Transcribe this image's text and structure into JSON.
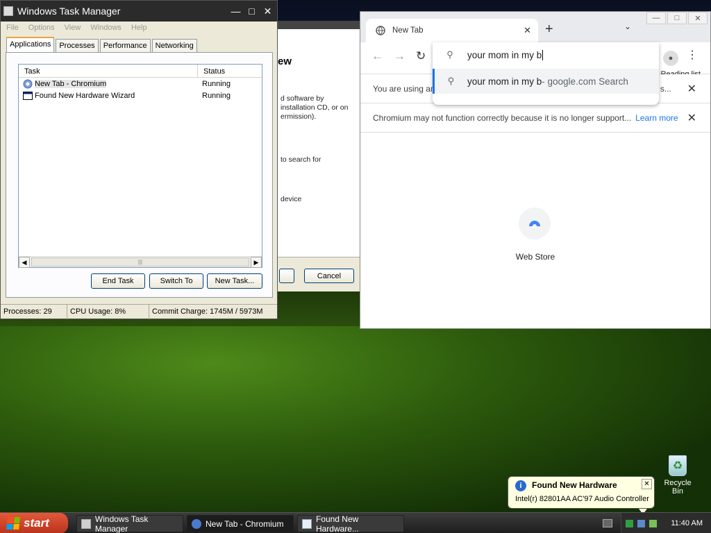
{
  "task_manager": {
    "title": "Windows Task Manager",
    "menu": [
      "File",
      "Options",
      "View",
      "Windows",
      "Help"
    ],
    "tabs": [
      "Applications",
      "Processes",
      "Performance",
      "Networking"
    ],
    "columns": {
      "task": "Task",
      "status": "Status"
    },
    "rows": [
      {
        "task": "New Tab - Chromium",
        "status": "Running"
      },
      {
        "task": "Found New Hardware Wizard",
        "status": "Running"
      }
    ],
    "buttons": {
      "end_task": "End Task",
      "switch_to": "Switch To",
      "new_task": "New Task..."
    },
    "status": {
      "processes": "Processes: 29",
      "cpu": "CPU Usage: 8%",
      "commit": "Commit Charge: 1745M / 5973M"
    }
  },
  "wizard": {
    "title_fragment": "ew",
    "p1": [
      "d software by",
      "installation CD, or on",
      "ermission)."
    ],
    "p2": "to search for",
    "p3": "device",
    "cancel": "Cancel"
  },
  "chromium": {
    "tab_title": "New Tab",
    "omnibox_value": "your mom in my b",
    "suggestion_main": "your mom in my b",
    "suggestion_dim": " - google.com Search",
    "reading_list": "Reading list",
    "infobar1": "You are using an unsupported command-line flag: --no-sandbox. Stability and s...",
    "infobar2": "Chromium may not function correctly because it is no longer support...",
    "learn_more": "Learn more",
    "tile_label": "Web Store"
  },
  "taskbar": {
    "start": "start",
    "buttons": [
      "Windows Task Manager",
      "New Tab - Chromium",
      "Found New Hardware..."
    ],
    "clock": "11:40 AM"
  },
  "balloon": {
    "title": "Found New Hardware",
    "body": "Intel(r) 82801AA AC'97 Audio Controller"
  },
  "desktop": {
    "recycle_bin": "Recycle Bin"
  }
}
